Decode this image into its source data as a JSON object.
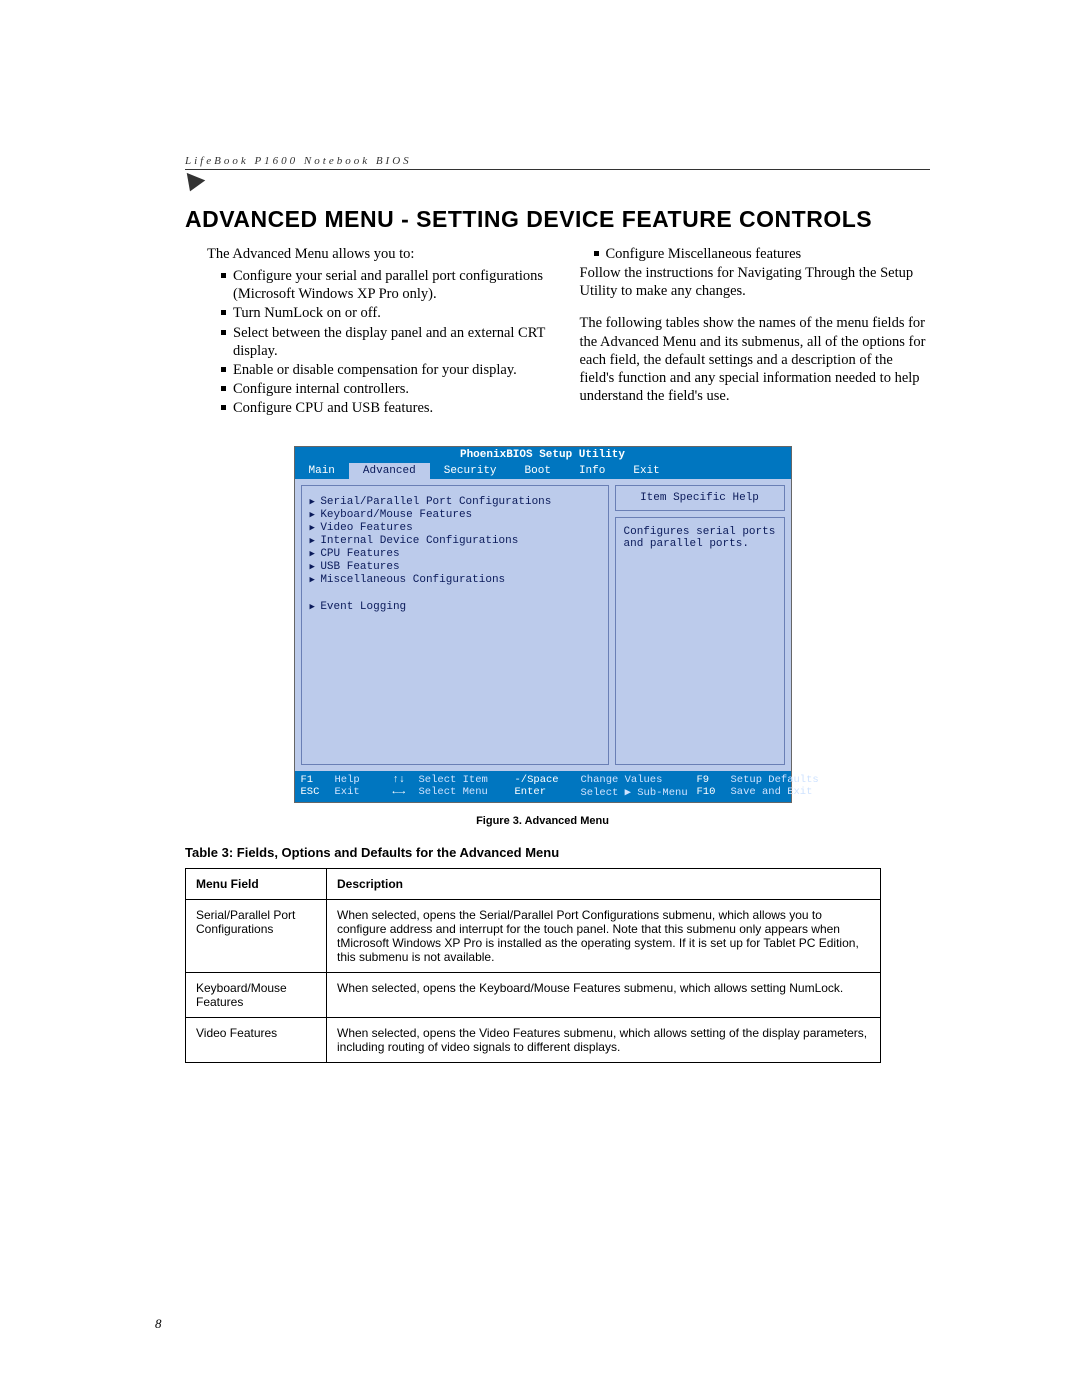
{
  "running_head": "LifeBook P1600 Notebook BIOS",
  "section_title": "Advanced Menu - Setting Device Feature Controls",
  "left_col": {
    "intro": "The Advanced Menu allows you to:",
    "items": [
      "Configure your serial and parallel port configurations (Microsoft Windows XP Pro only).",
      "Turn NumLock on or off.",
      "Select between the display panel and an external CRT display.",
      "Enable or disable compensation for your display.",
      "Configure internal controllers.",
      "Configure CPU and USB features."
    ]
  },
  "right_col": {
    "first_item": "Configure Miscellaneous features",
    "p1": "Follow the instructions for Navigating Through the Setup Utility to make any changes.",
    "p2": "The following tables show the names of the menu fields for the Advanced Menu and its submenus, all of the options for each field, the default settings and a description of the field's function and any special information needed to help understand the field's use."
  },
  "bios": {
    "title": "PhoenixBIOS Setup Utility",
    "tabs": [
      "Main",
      "Advanced",
      "Security",
      "Boot",
      "Info",
      "Exit"
    ],
    "active_tab": "Advanced",
    "items_group1": [
      "Serial/Parallel Port Configurations",
      "Keyboard/Mouse Features",
      "Video Features",
      "Internal Device Configurations",
      "CPU Features",
      "USB Features",
      "Miscellaneous Configurations"
    ],
    "items_group2": [
      "Event Logging"
    ],
    "help_title": "Item Specific Help",
    "help_text": "Configures serial ports and parallel ports.",
    "footer": {
      "r1": {
        "k1": "F1",
        "v1": "Help",
        "k2": "↑↓",
        "v2": "Select Item",
        "k3": "-/Space",
        "v3": "Change Values",
        "k4": "F9",
        "v4": "Setup Defaults"
      },
      "r2": {
        "k1": "ESC",
        "v1": "Exit",
        "k2": "←→",
        "v2": "Select Menu",
        "k3": "Enter",
        "v3": "Select ▶ Sub-Menu",
        "k4": "F10",
        "v4": "Save and Exit"
      }
    }
  },
  "figure_caption": "Figure 3.  Advanced Menu",
  "table_caption": "Table 3: Fields, Options and Defaults for the Advanced Menu",
  "table": {
    "headers": [
      "Menu Field",
      "Description"
    ],
    "rows": [
      {
        "field": "Serial/Parallel Port Configurations",
        "desc": "When selected, opens the Serial/Parallel Port Configurations submenu, which allows you to configure address and interrupt for the touch panel. Note that this submenu only appears when tMicrosoft Windows XP Pro is installed as the operating system. If it is set up for Tablet PC Edition, this submenu is not available."
      },
      {
        "field": "Keyboard/Mouse Features",
        "desc": "When selected, opens the Keyboard/Mouse Features submenu, which allows setting NumLock."
      },
      {
        "field": "Video Features",
        "desc": "When selected, opens the Video Features submenu, which allows setting of the display parameters, including routing of video signals to different displays."
      }
    ]
  },
  "page_num": "8"
}
